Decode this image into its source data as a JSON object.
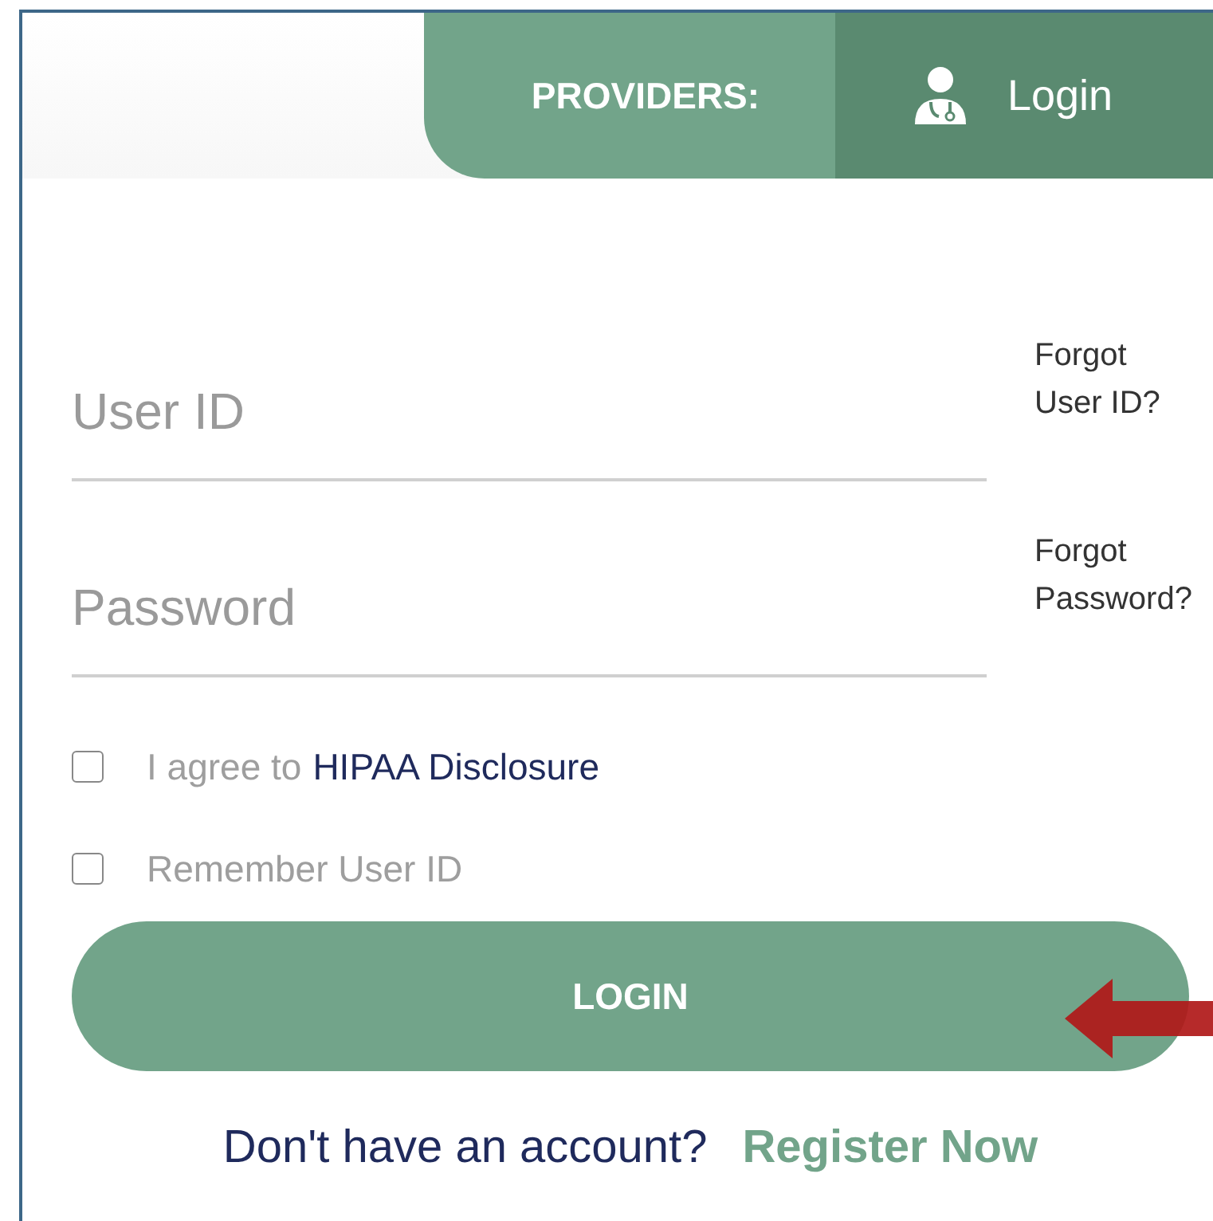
{
  "header": {
    "label": "PROVIDERS:",
    "login_link": "Login"
  },
  "fields": [
    {
      "placeholder": "User ID",
      "help_line1": "Forgot",
      "help_line2": "User ID?"
    },
    {
      "placeholder": "Password",
      "help_line1": "Forgot",
      "help_line2": "Password?"
    }
  ],
  "checkboxes": [
    {
      "label": "I agree to",
      "link": "HIPAA Disclosure",
      "checked": false
    },
    {
      "label": "Remember User ID",
      "checked": false
    }
  ],
  "login_button": "LOGIN",
  "register": {
    "prompt": "Don't have an account?",
    "link": "Register Now"
  }
}
